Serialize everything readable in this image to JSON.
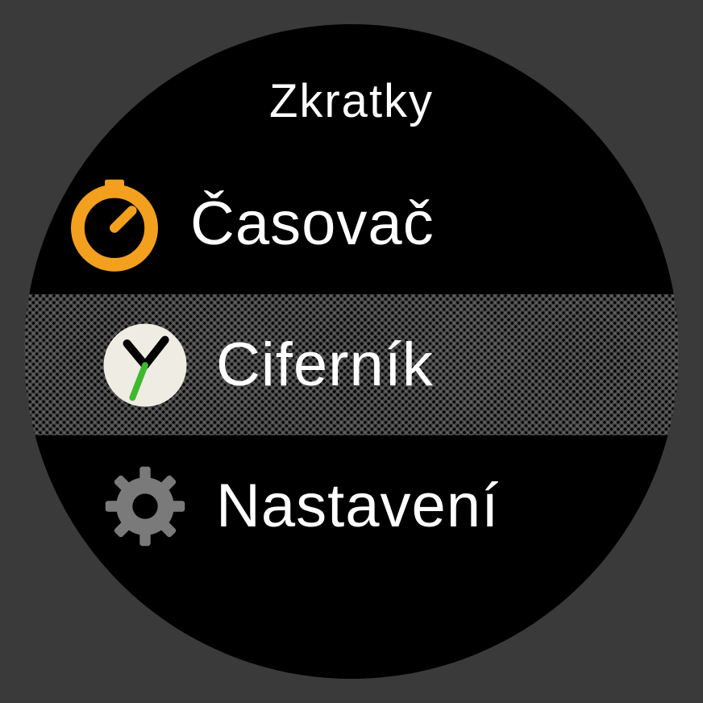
{
  "header": {
    "title": "Zkratky"
  },
  "menu": {
    "items": [
      {
        "label": "Časovač",
        "icon": "timer-icon"
      },
      {
        "label": "Ciferník",
        "icon": "watchface-icon"
      },
      {
        "label": "Nastavení",
        "icon": "settings-icon"
      }
    ],
    "selected_index": 1
  },
  "colors": {
    "accent_orange": "#f2a01e",
    "accent_green": "#3eb82e",
    "icon_gray": "#7a7a7a",
    "icon_white": "#efece4"
  }
}
